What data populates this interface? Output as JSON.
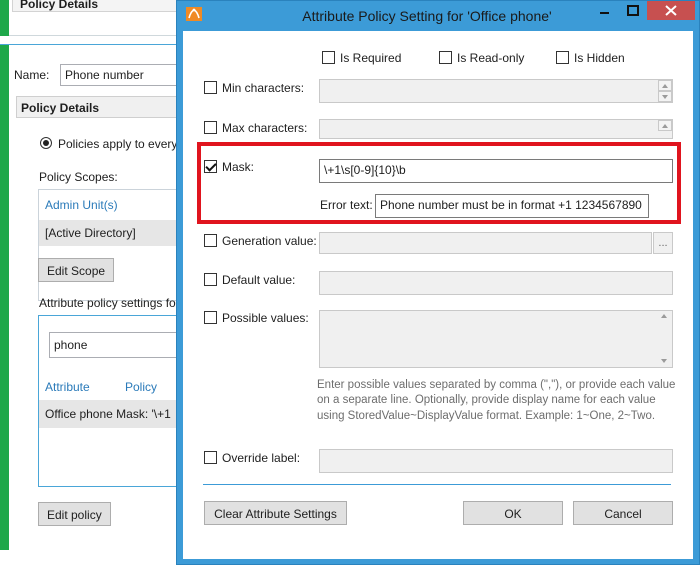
{
  "background": {
    "top_header": "Policy Details",
    "name_label": "Name:",
    "name_value": "Phone number",
    "section_header": "Policy Details",
    "radio_label": "Policies apply to every",
    "scopes_label": "Policy Scopes:",
    "scopes_header": "Admin Unit(s)",
    "scopes_row": "[Active Directory]",
    "edit_scope_button": "Edit Scope",
    "attr_settings_label": "Attribute policy settings fo",
    "attr_search_value": "phone",
    "attr_columns": [
      "Attribute",
      "Policy"
    ],
    "attr_row": "Office phone  Mask: '\\+1",
    "edit_policy_button": "Edit policy"
  },
  "dialog": {
    "title": "Attribute Policy Setting for 'Office phone'",
    "accent_color": "#3c9bd7",
    "highlight_color": "#e0141e",
    "top_options": {
      "required": "Is Required",
      "readonly": "Is Read-only",
      "hidden": "Is Hidden"
    },
    "min_chars_label": "Min characters:",
    "max_chars_label": "Max characters:",
    "mask_label": "Mask:",
    "mask_value": "\\+1\\s[0-9]{10}\\b",
    "error_text_label": "Error text:",
    "error_text_value": "Phone number must be in format +1 1234567890",
    "generation_label": "Generation value:",
    "ellipsis": "...",
    "default_label": "Default value:",
    "possible_label": "Possible values:",
    "possible_hint": "Enter possible values separated by comma (\",\"), or provide each value on a separate line. Optionally, provide display name for each value using StoredValue~DisplayValue format. Example: 1~One, 2~Two.",
    "override_label": "Override label:",
    "buttons": {
      "clear": "Clear Attribute Settings",
      "ok": "OK",
      "cancel": "Cancel"
    }
  }
}
